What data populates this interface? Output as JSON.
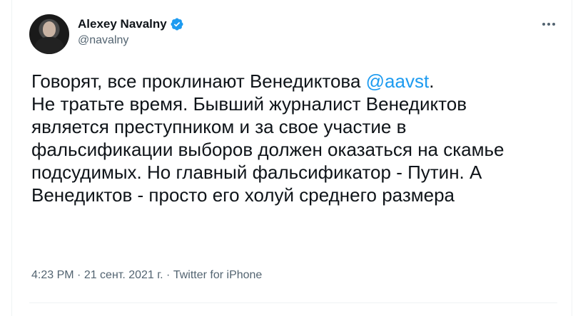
{
  "author": {
    "display_name": "Alexey Navalny",
    "handle": "@navalny",
    "verified": true,
    "verified_icon": "verified-badge-icon",
    "verified_color": "#1d9bf0"
  },
  "tweet": {
    "text_before": "Говорят, все проклинают Венедиктова ",
    "mention": "@aavst",
    "text_after": ".\nНе тратьте время. Бывший журналист Венедиктов является преступником и за свое участие в фальсификации выборов должен оказаться на скамье подсудимых. Но главный фальсификатор - Путин. А Венедиктов - просто его холуй среднего размера"
  },
  "meta": {
    "time": "4:23 PM",
    "separator": " · ",
    "date": "21 сент. 2021 г.",
    "source": "Twitter for iPhone"
  },
  "colors": {
    "text": "#0f1419",
    "secondary": "#536471",
    "link": "#1d9bf0",
    "border": "#eff3f4"
  }
}
